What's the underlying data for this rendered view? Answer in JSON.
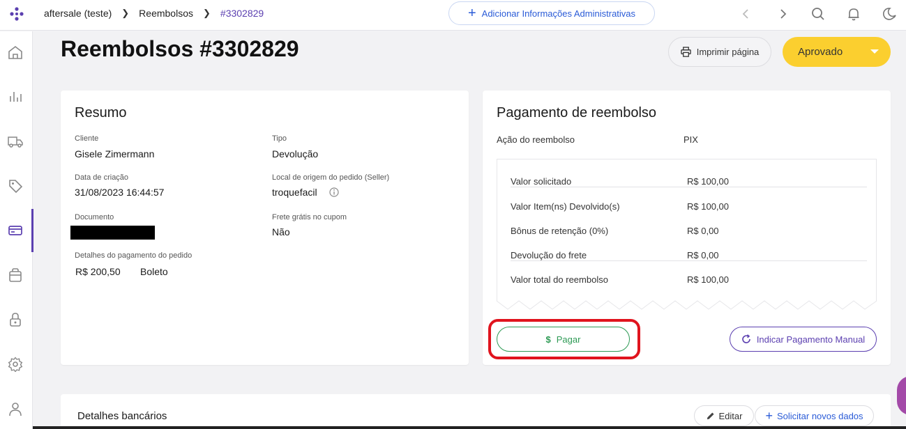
{
  "breadcrumb": {
    "items": [
      "aftersale (teste)",
      "Reembolsos",
      "#3302829"
    ]
  },
  "header": {
    "admin_button": "Adicionar Informações Administrativas"
  },
  "page": {
    "title": "Reembolsos #3302829",
    "print_button": "Imprimir página",
    "status_button": "Aprovado"
  },
  "resumo": {
    "title": "Resumo",
    "cliente_label": "Cliente",
    "cliente_value": "Gisele Zimermann",
    "tipo_label": "Tipo",
    "tipo_value": "Devolução",
    "data_label": "Data de criação",
    "data_value": "31/08/2023 16:44:57",
    "origem_label": "Local de origem do pedido (Seller)",
    "origem_value": "troquefacil",
    "documento_label": "Documento",
    "frete_label": "Frete grátis no cupom",
    "frete_value": "Não",
    "pagamento_label": "Detalhes do pagamento do pedido",
    "pagamento_valor": "R$ 200,50",
    "pagamento_metodo": "Boleto"
  },
  "pagamento": {
    "title": "Pagamento de reembolso",
    "acao_label": "Ação do reembolso",
    "acao_value": "PIX",
    "rows": [
      {
        "label": "Valor solicitado",
        "value": "R$ 100,00"
      },
      {
        "label": "Valor Item(ns) Devolvido(s)",
        "value": "R$ 100,00"
      },
      {
        "label": "Bônus de retenção (0%)",
        "value": "R$ 0,00"
      },
      {
        "label": "Devolução do frete",
        "value": "R$ 0,00"
      },
      {
        "label": "Valor total do reembolso",
        "value": "R$ 100,00"
      }
    ],
    "pay_button": "Pagar",
    "manual_button": "Indicar Pagamento Manual"
  },
  "bancarios": {
    "title": "Detalhes bancários",
    "edit_button": "Editar",
    "request_button": "Solicitar novos dados"
  },
  "colors": {
    "accent": "#5b3fb0",
    "link": "#2a5bd7",
    "status": "#fbcf2f",
    "pay": "#2e9a55",
    "highlight": "#e0141e"
  },
  "icons": {
    "sidebar": [
      "home-icon",
      "chart-icon",
      "truck-icon",
      "tag-icon",
      "card-icon",
      "bag-icon",
      "lock-icon",
      "gear-icon",
      "user-icon"
    ],
    "topbar": [
      "chevron-left-icon",
      "chevron-right-icon",
      "search-icon",
      "bell-icon",
      "moon-icon"
    ]
  }
}
